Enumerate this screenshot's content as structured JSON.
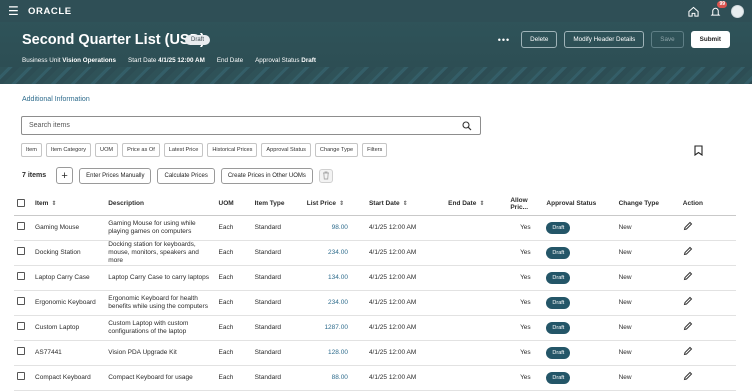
{
  "topbar": {
    "brand": "ORACLE",
    "notification_count": "99"
  },
  "header": {
    "title": "Second Quarter List (USD)",
    "status_pill": "Draft",
    "meta": [
      {
        "label": "Business Unit",
        "value": "Vision Operations"
      },
      {
        "label": "Start Date",
        "value": "4/1/25 12:00 AM"
      },
      {
        "label": "End Date",
        "value": ""
      },
      {
        "label": "Approval Status",
        "value": "Draft"
      }
    ],
    "buttons": {
      "more": "•••",
      "delete": "Delete",
      "modify": "Modify Header Details",
      "save": "Save",
      "submit": "Submit"
    }
  },
  "additional_info": "Additional Information",
  "search": {
    "placeholder": "Search items"
  },
  "filter_chips": [
    "Item",
    "Item Category",
    "UOM",
    "Price as Of",
    "Latest Price",
    "Historical Prices",
    "Approval Status",
    "Change Type",
    "Filters"
  ],
  "toolbar": {
    "count": "7 items",
    "enter_prices": "Enter Prices Manually",
    "calculate": "Calculate Prices",
    "create_uom": "Create Prices in Other UOMs"
  },
  "columns": [
    "Item",
    "Description",
    "UOM",
    "Item Type",
    "List Price",
    "Start Date",
    "End Date",
    "Allow Pric...",
    "Approval Status",
    "Change Type",
    "Action"
  ],
  "rows": [
    {
      "item": "Gaming Mouse",
      "description": "Gaming Mouse for using while playing games on computers",
      "uom": "Each",
      "item_type": "Standard",
      "list_price": "98.00",
      "start_date": "4/1/25 12:00 AM",
      "end_date": "",
      "allow": "Yes",
      "status": "Draft",
      "change_type": "New"
    },
    {
      "item": "Docking Station",
      "description": "Docking station for keyboards, mouse, monitors, speakers and more",
      "uom": "Each",
      "item_type": "Standard",
      "list_price": "234.00",
      "start_date": "4/1/25 12:00 AM",
      "end_date": "",
      "allow": "Yes",
      "status": "Draft",
      "change_type": "New"
    },
    {
      "item": "Laptop Carry Case",
      "description": "Laptop Carry Case to carry laptops",
      "uom": "Each",
      "item_type": "Standard",
      "list_price": "134.00",
      "start_date": "4/1/25 12:00 AM",
      "end_date": "",
      "allow": "Yes",
      "status": "Draft",
      "change_type": "New"
    },
    {
      "item": "Ergonomic Keyboard",
      "description": "Ergonomic Keyboard for health benefits while using the computers",
      "uom": "Each",
      "item_type": "Standard",
      "list_price": "234.00",
      "start_date": "4/1/25 12:00 AM",
      "end_date": "",
      "allow": "Yes",
      "status": "Draft",
      "change_type": "New"
    },
    {
      "item": "Custom Laptop",
      "description": "Custom Laptop with custom configurations of the laptop",
      "uom": "Each",
      "item_type": "Standard",
      "list_price": "1287.00",
      "start_date": "4/1/25 12:00 AM",
      "end_date": "",
      "allow": "Yes",
      "status": "Draft",
      "change_type": "New"
    },
    {
      "item": "AS77441",
      "description": "Vision PDA Upgrade Kit",
      "uom": "Each",
      "item_type": "Standard",
      "list_price": "128.00",
      "start_date": "4/1/25 12:00 AM",
      "end_date": "",
      "allow": "Yes",
      "status": "Draft",
      "change_type": "New"
    },
    {
      "item": "Compact Keyboard",
      "description": "Compact Keyboard for usage",
      "uom": "Each",
      "item_type": "Standard",
      "list_price": "88.00",
      "start_date": "4/1/25 12:00 AM",
      "end_date": "",
      "allow": "Yes",
      "status": "Draft",
      "change_type": "New"
    }
  ]
}
